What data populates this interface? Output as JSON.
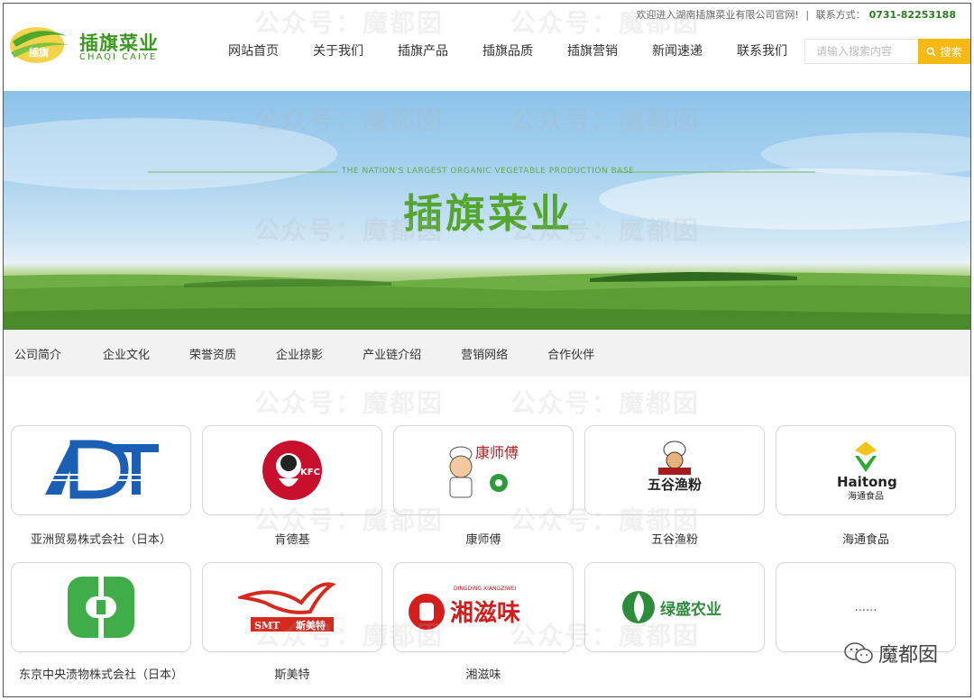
{
  "header": {
    "welcome": "欢迎进入湖南插旗菜业有限公司官网!",
    "separator": "|",
    "contact_label": "联系方式：",
    "phone": "0731-82253188"
  },
  "logo": {
    "cn": "插旗菜业",
    "en": "CHAQI CAIYE",
    "mark_text": "插旗"
  },
  "nav": [
    "网站首页",
    "关于我们",
    "插旗产品",
    "插旗品质",
    "插旗营销",
    "新闻速递",
    "联系我们"
  ],
  "search": {
    "placeholder": "请输入搜索内容",
    "button": "搜索"
  },
  "banner": {
    "subtitle": "THE NATION'S LARGEST ORGANIC VEGETABLE PRODUCTION BASE",
    "title": "插旗菜业"
  },
  "subnav": [
    "公司简介",
    "企业文化",
    "荣誉资质",
    "企业掠影",
    "产业链介绍",
    "营销网络",
    "合作伙伴"
  ],
  "partners": [
    {
      "name": "亚洲贸易株式会社（日本）",
      "logo": "ADT"
    },
    {
      "name": "肯德基",
      "logo": "KFC"
    },
    {
      "name": "康师傅",
      "logo": "康师傅"
    },
    {
      "name": "五谷渔粉",
      "logo": "五谷渔粉"
    },
    {
      "name": "海通食品",
      "logo": "Haitong",
      "logo_sub": "海通食品"
    },
    {
      "name": "东京中央渍物株式会社（日本）",
      "logo": ""
    },
    {
      "name": "斯美特",
      "logo": "SMT",
      "logo_sub": "斯美特"
    },
    {
      "name": "湘滋味",
      "logo": "湘滋味",
      "logo_sub": "DINGDING XIANGZIWEI"
    },
    {
      "name": "",
      "logo": "绿盛农业"
    },
    {
      "name": "",
      "logo": "......"
    }
  ],
  "watermark": {
    "text": "公众号：魔都囡",
    "brand": "魔都囡"
  },
  "colors": {
    "brand_green": "#3b9a1f",
    "search_yellow": "#f6b914",
    "subnav_bg": "#f2f2f2"
  }
}
